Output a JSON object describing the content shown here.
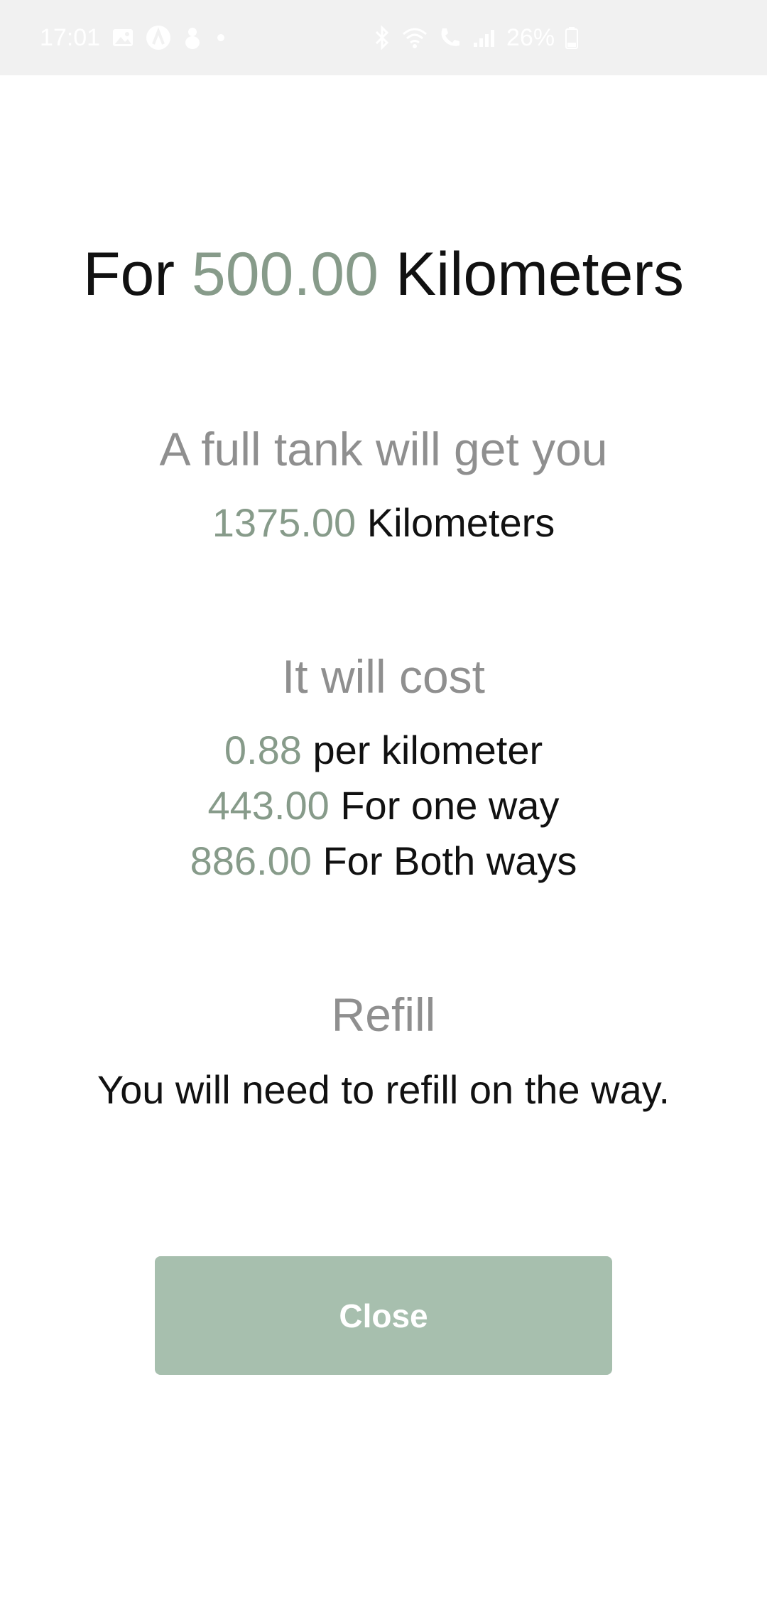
{
  "status_bar": {
    "time": "17:01",
    "battery": "26%",
    "left_icons": [
      "image-icon",
      "app-a-icon",
      "notification-icon",
      "dot-icon"
    ],
    "right_icons": [
      "bluetooth-icon",
      "wifi-icon",
      "call-icon",
      "signal-icon",
      "battery-icon"
    ]
  },
  "title": {
    "prefix": "For",
    "distance": "500.00",
    "unit": "Kilometers"
  },
  "range": {
    "heading": "A full tank will get you",
    "value": "1375.00",
    "unit": "Kilometers"
  },
  "cost": {
    "heading": "It will cost",
    "lines": [
      {
        "value": "0.88",
        "label": "per kilometer"
      },
      {
        "value": "443.00",
        "label": "For one way"
      },
      {
        "value": "886.00",
        "label": "For Both ways"
      }
    ]
  },
  "refill": {
    "heading": "Refill",
    "message": "You will need to refill on the way."
  },
  "close_button": {
    "label": "Close"
  },
  "colors": {
    "accent": "#879b8a",
    "heading_gray": "#8f8f8f",
    "button_bg": "#a7bfae",
    "status_bar_bg": "#f1f1f1"
  }
}
